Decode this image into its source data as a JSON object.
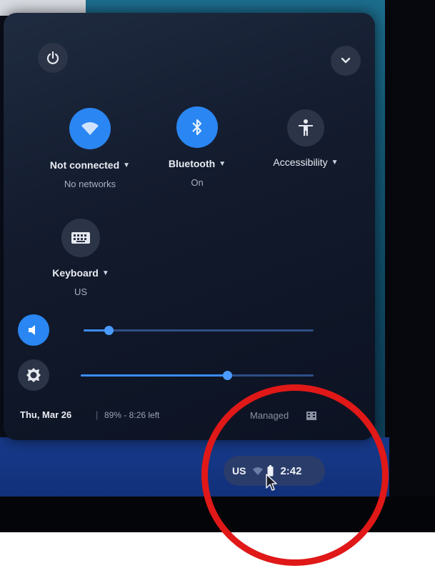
{
  "panel": {
    "power_button": {
      "icon": "power-icon"
    },
    "collapse_button": {
      "icon": "chevron-down-icon"
    },
    "tiles": [
      {
        "label": "Not connected",
        "sublabel": "No networks",
        "icon": "wifi-icon",
        "active": true
      },
      {
        "label": "Bluetooth",
        "sublabel": "On",
        "icon": "bluetooth-icon",
        "active": true
      },
      {
        "label": "Accessibility",
        "sublabel": "",
        "icon": "accessibility-icon",
        "active": false
      },
      {
        "label": "Keyboard",
        "sublabel": "US",
        "icon": "keyboard-icon",
        "active": false
      }
    ],
    "sliders": [
      {
        "name": "volume",
        "icon": "volume-icon",
        "level": 0.11
      },
      {
        "name": "brightness",
        "icon": "brightness-icon",
        "level": 0.63
      }
    ],
    "footer": {
      "date": "Thu, Mar 26",
      "battery": "89% - 8:26 left",
      "managed": "Managed"
    }
  },
  "tray": {
    "keyboard_layout": "US",
    "status_icons": [
      "wifi-icon",
      "battery-icon"
    ],
    "time": "2:42"
  },
  "colors": {
    "accent": "#2a86f2",
    "annotation": "#e01818",
    "panel_bg": "#121a2c"
  }
}
